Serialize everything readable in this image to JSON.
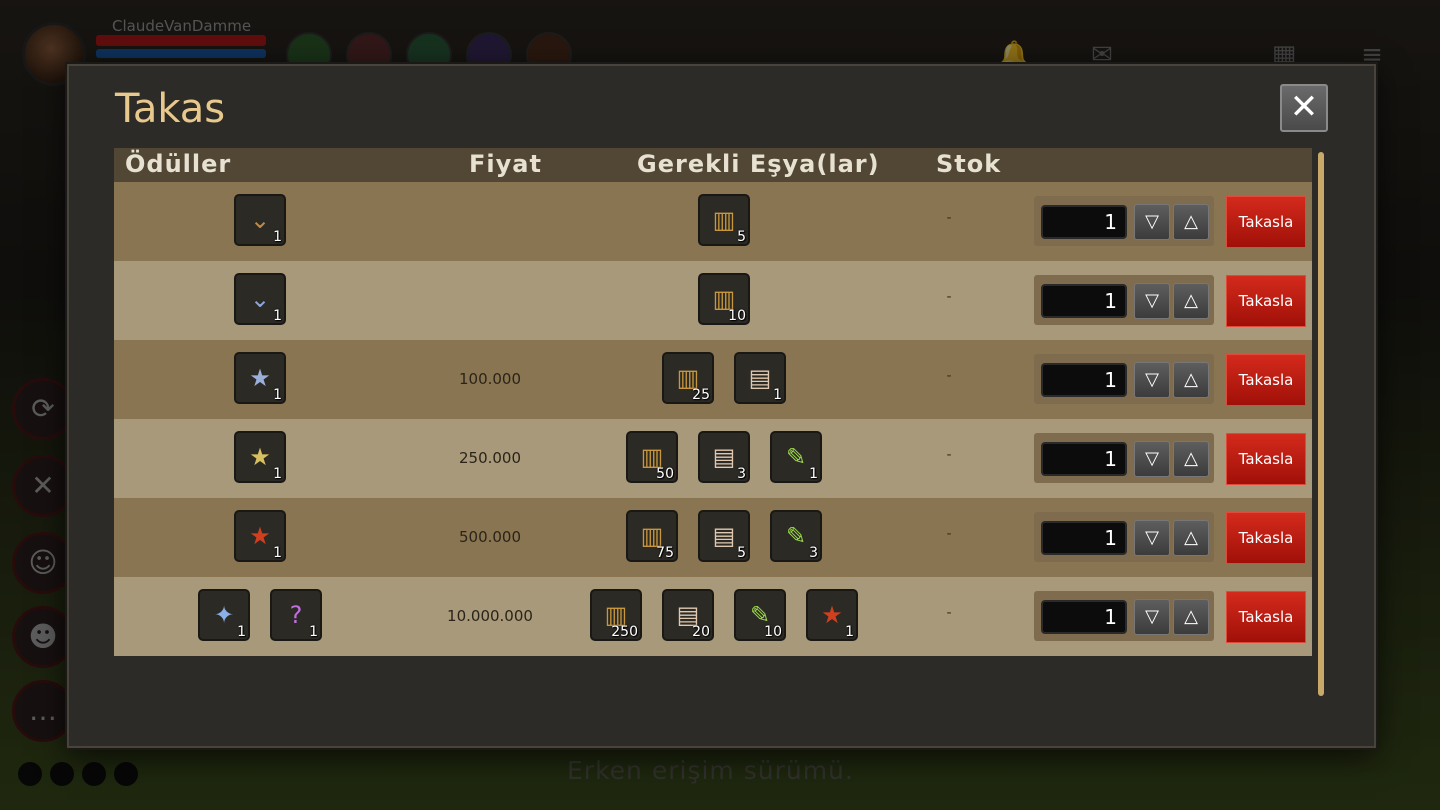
{
  "hud": {
    "player_name": "ClaudeVanDamme",
    "footer_text": "Erken erişim sürümü."
  },
  "dialog": {
    "title": "Takas",
    "close_label": "✕",
    "headers": {
      "rewards": "Ödüller",
      "price": "Fiyat",
      "required_items": "Gerekli Eşya(lar)",
      "stock": "Stok"
    },
    "rows": [
      {
        "rewards": [
          {
            "icon": "bronze-badge-icon",
            "glyph": "⌄",
            "color": "#c08a4a",
            "qty": "1"
          }
        ],
        "price": "",
        "required": [
          {
            "icon": "bullets-icon",
            "glyph": "▥",
            "color": "#c8963c",
            "qty": "5"
          }
        ],
        "stock": "-",
        "quantity": "1",
        "trade_label": "Takasla"
      },
      {
        "rewards": [
          {
            "icon": "silver-chevron-badge-icon",
            "glyph": "⌄",
            "color": "#8aa6d8",
            "qty": "1"
          }
        ],
        "price": "",
        "required": [
          {
            "icon": "bullets-icon",
            "glyph": "▥",
            "color": "#c8963c",
            "qty": "10"
          }
        ],
        "stock": "-",
        "quantity": "1",
        "trade_label": "Takasla"
      },
      {
        "rewards": [
          {
            "icon": "star-chevron-badge-icon",
            "glyph": "★",
            "color": "#9ab0d8",
            "qty": "1"
          }
        ],
        "price": "100.000",
        "required": [
          {
            "icon": "bullets-icon",
            "glyph": "▥",
            "color": "#c8963c",
            "qty": "25"
          },
          {
            "icon": "document-icon",
            "glyph": "▤",
            "color": "#e0c8b0",
            "qty": "1"
          }
        ],
        "stock": "-",
        "quantity": "1",
        "trade_label": "Takasla"
      },
      {
        "rewards": [
          {
            "icon": "gold-star-medal-icon",
            "glyph": "★",
            "color": "#d8c060",
            "qty": "1"
          }
        ],
        "price": "250.000",
        "required": [
          {
            "icon": "bullets-icon",
            "glyph": "▥",
            "color": "#c8963c",
            "qty": "50"
          },
          {
            "icon": "document-icon",
            "glyph": "▤",
            "color": "#e0c8b0",
            "qty": "3"
          },
          {
            "icon": "sealed-scroll-icon",
            "glyph": "✎",
            "color": "#9ad84a",
            "qty": "1"
          }
        ],
        "stock": "-",
        "quantity": "1",
        "trade_label": "Takasla"
      },
      {
        "rewards": [
          {
            "icon": "red-star-medal-icon",
            "glyph": "★",
            "color": "#d04020",
            "qty": "1"
          }
        ],
        "price": "500.000",
        "required": [
          {
            "icon": "bullets-icon",
            "glyph": "▥",
            "color": "#c8963c",
            "qty": "75"
          },
          {
            "icon": "document-icon",
            "glyph": "▤",
            "color": "#e0c8b0",
            "qty": "5"
          },
          {
            "icon": "sealed-scroll-icon",
            "glyph": "✎",
            "color": "#9ad84a",
            "qty": "3"
          }
        ],
        "stock": "-",
        "quantity": "1",
        "trade_label": "Takasla"
      },
      {
        "rewards": [
          {
            "icon": "winged-globe-badge-icon",
            "glyph": "✦",
            "color": "#8ab0e8",
            "qty": "1"
          },
          {
            "icon": "mystery-chest-icon",
            "glyph": "?",
            "color": "#c070e0",
            "qty": "1"
          }
        ],
        "price": "10.000.000",
        "required": [
          {
            "icon": "bullets-icon",
            "glyph": "▥",
            "color": "#c8963c",
            "qty": "250"
          },
          {
            "icon": "document-icon",
            "glyph": "▤",
            "color": "#e0c8b0",
            "qty": "20"
          },
          {
            "icon": "sealed-scroll-icon",
            "glyph": "✎",
            "color": "#9ad84a",
            "qty": "10"
          },
          {
            "icon": "red-star-medal-icon",
            "glyph": "★",
            "color": "#d04020",
            "qty": "1"
          }
        ],
        "stock": "-",
        "quantity": "1",
        "trade_label": "Takasla"
      }
    ],
    "stepper_down": "▽",
    "stepper_up": "△"
  }
}
